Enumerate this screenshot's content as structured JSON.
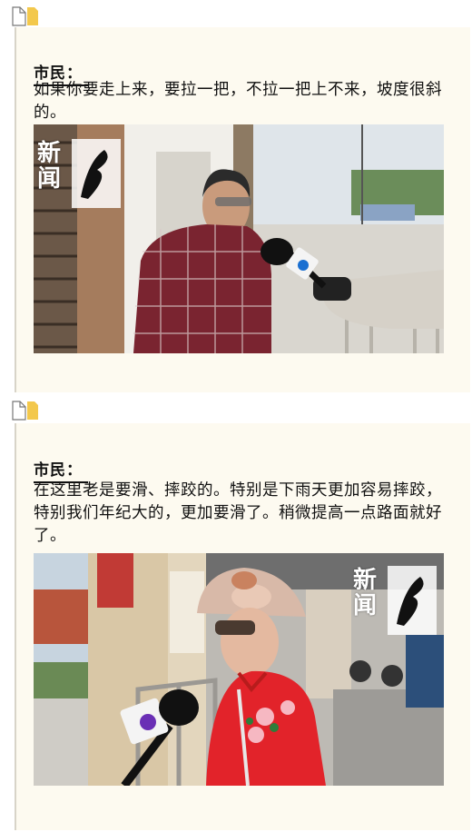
{
  "blocks": [
    {
      "speaker": "市民：",
      "quote": "如果你要走上来，要拉一把，不拉一把上不来，坡度很斜的。",
      "photo_logo": "新闻坊"
    },
    {
      "speaker": "市民：",
      "quote": "在这里老是要滑、摔跤的。特别是下雨天更加容易摔跤，特别我们年纪大的，更加要滑了。稍微提高一点路面就好了。",
      "photo_logo": "新闻坊"
    }
  ],
  "colors": {
    "accent_yellow": "#f3c84c",
    "card_bg": "#fdfaf0",
    "line": "#d8d4c8"
  }
}
